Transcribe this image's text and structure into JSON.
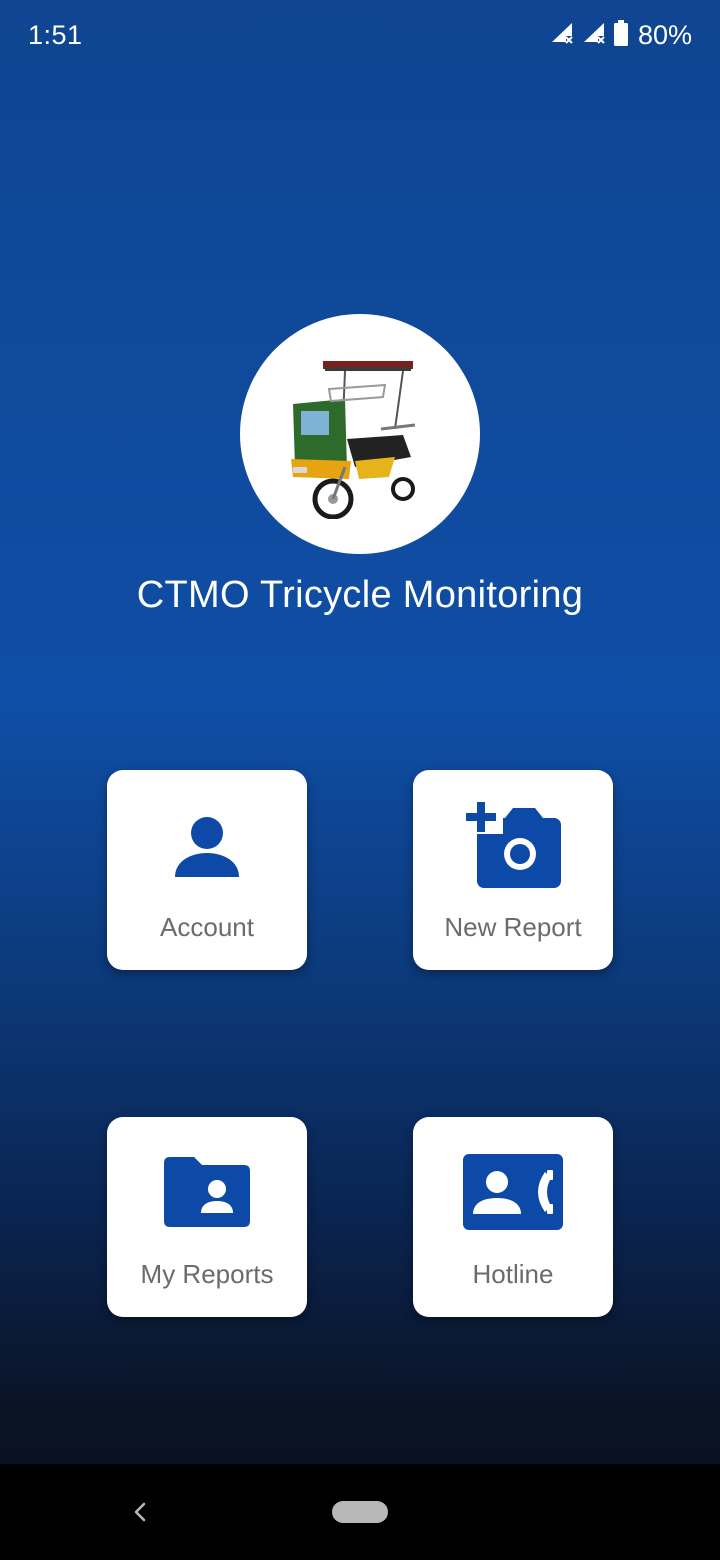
{
  "status_bar": {
    "time": "1:51",
    "battery_percent": "80%",
    "icons": [
      "signal-no-data-icon",
      "signal-no-data-icon",
      "battery-icon"
    ]
  },
  "app": {
    "title": "CTMO Tricycle Monitoring",
    "logo_icon": "tricycle-logo-icon"
  },
  "menu": {
    "account": {
      "label": "Account",
      "icon": "person-icon"
    },
    "new_report": {
      "label": "New Report",
      "icon": "add-camera-icon"
    },
    "my_reports": {
      "label": "My Reports",
      "icon": "folder-shared-icon"
    },
    "hotline": {
      "label": "Hotline",
      "icon": "contact-phone-icon"
    }
  },
  "colors": {
    "accent": "#0f4ea6",
    "tile_icon": "#0d4aa8",
    "tile_label": "#6b6b6b"
  },
  "nav_bar": {
    "icons": [
      "back-icon",
      "home-pill-icon"
    ]
  }
}
